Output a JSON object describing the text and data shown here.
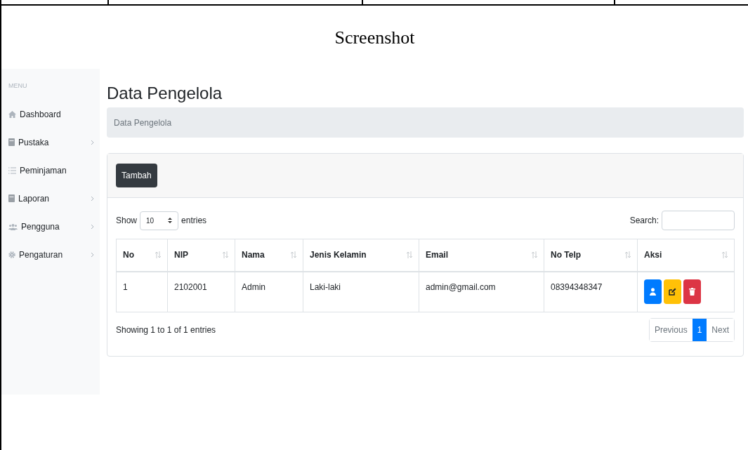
{
  "caption": "Screenshot",
  "sidebar": {
    "heading": "MENU",
    "items": [
      {
        "label": "Dashboard",
        "kind": "home",
        "has_children": false
      },
      {
        "label": "Pustaka",
        "kind": "book",
        "has_children": true
      },
      {
        "label": "Peminjaman",
        "kind": "list",
        "has_children": false
      },
      {
        "label": "Laporan",
        "kind": "book",
        "has_children": true
      },
      {
        "label": "Pengguna",
        "kind": "users",
        "has_children": true
      },
      {
        "label": "Pengaturan",
        "kind": "gear",
        "has_children": true
      }
    ]
  },
  "page_title": "Data Pengelola",
  "breadcrumb": "Data Pengelola",
  "add_button": "Tambah",
  "length": {
    "prefix": "Show",
    "value": "10",
    "suffix": "entries"
  },
  "search": {
    "label": "Search:"
  },
  "table": {
    "columns": [
      "No",
      "NIP",
      "Nama",
      "Jenis Kelamin",
      "Email",
      "No Telp",
      "Aksi"
    ],
    "rows": [
      {
        "cells": [
          "1",
          "2102001",
          "Admin",
          "Laki-laki",
          "admin@gmail.com",
          "08394348347"
        ],
        "actions": [
          {
            "kind": "detail"
          },
          {
            "kind": "edit"
          },
          {
            "kind": "delete"
          }
        ]
      }
    ]
  },
  "info": "Showing 1 to 1 of 1 entries",
  "pagination": [
    {
      "label": "Previous",
      "selected": false
    },
    {
      "label": "1",
      "selected": true
    },
    {
      "label": "Next",
      "selected": false
    }
  ]
}
